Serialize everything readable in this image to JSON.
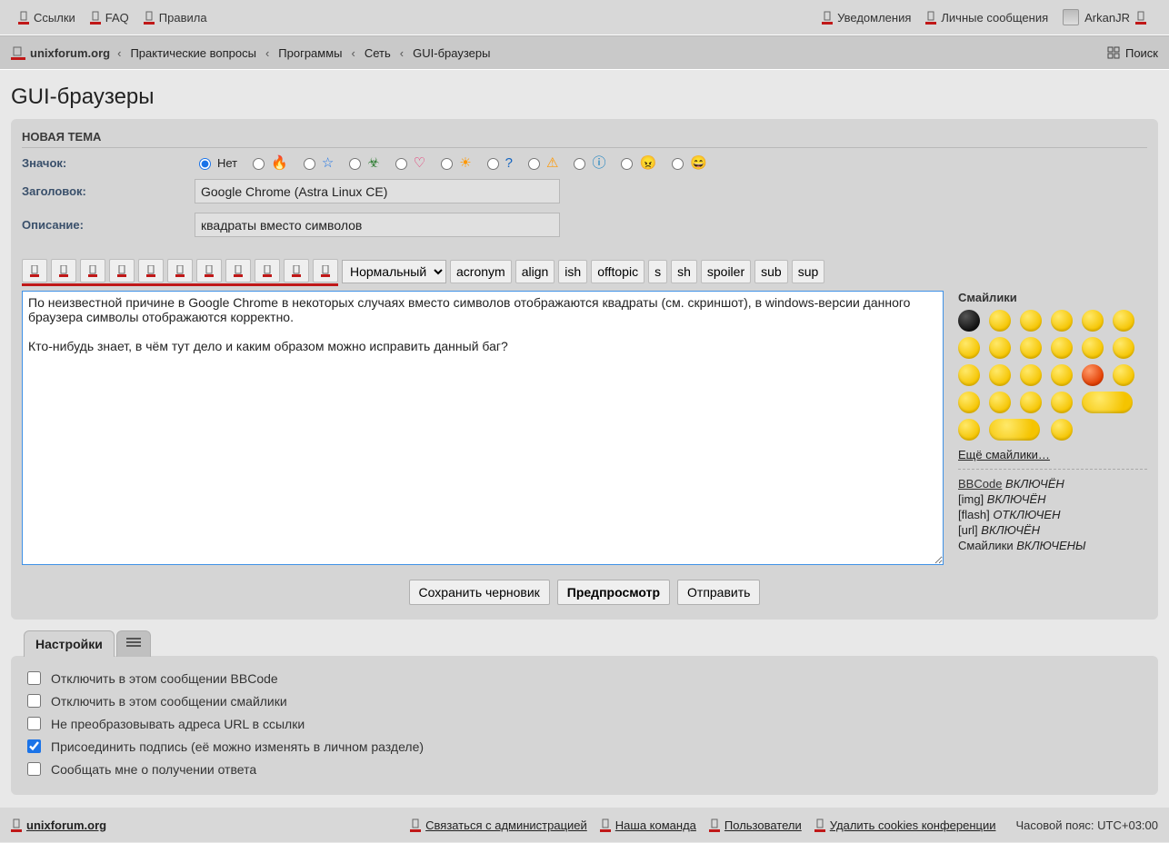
{
  "topbar": {
    "left": [
      {
        "label": "Ссылки"
      },
      {
        "label": "FAQ"
      },
      {
        "label": "Правила"
      }
    ],
    "right": [
      {
        "label": "Уведомления"
      },
      {
        "label": "Личные сообщения"
      }
    ],
    "username": "ArkanJR"
  },
  "breadcrumb": {
    "home": "unixforum.org",
    "items": [
      "Практические вопросы",
      "Программы",
      "Сеть",
      "GUI-браузеры"
    ],
    "search": "Поиск"
  },
  "page_title": "GUI-браузеры",
  "panel": {
    "heading": "НОВАЯ ТЕМА",
    "labels": {
      "icon": "Значок:",
      "subject": "Заголовок:",
      "desc": "Описание:"
    },
    "icon_none": "Нет",
    "subject_value": "Google Chrome (Astra Linux CE)",
    "desc_value": "квадраты вместо символов"
  },
  "topic_icons": [
    {
      "key": "none",
      "label": "Нет",
      "checked": true
    },
    {
      "key": "fire",
      "glyph": "🔥"
    },
    {
      "key": "star",
      "glyph": "☆",
      "color": "#1a73e8"
    },
    {
      "key": "biohazard",
      "glyph": "☣",
      "color": "#2e7d32"
    },
    {
      "key": "heart",
      "glyph": "♡",
      "color": "#e91e63"
    },
    {
      "key": "sun",
      "glyph": "☀",
      "color": "#ff9800"
    },
    {
      "key": "help",
      "glyph": "?",
      "color": "#1565c0"
    },
    {
      "key": "warn",
      "glyph": "⚠",
      "color": "#ff9800"
    },
    {
      "key": "info",
      "glyph": "ⓘ",
      "color": "#0277bd"
    },
    {
      "key": "angry",
      "glyph": "😠"
    },
    {
      "key": "mrgreen",
      "glyph": "😄"
    }
  ],
  "format_buttons_count": 11,
  "fontsize_selected": "Нормальный",
  "bbcode_buttons": [
    "acronym",
    "align",
    "ish",
    "offtopic",
    "s",
    "sh",
    "spoiler",
    "sub",
    "sup"
  ],
  "message": "По неизвестной причине в Google Chrome в некоторых случаях вместо символов отображаются квадраты (см. скриншот), в windows-версии данного браузера символы отображаются корректно.\n\nКто-нибудь знает, в чём тут дело и каким образом можно исправить данный баг?",
  "side": {
    "heading": "Смайлики",
    "more": "Ещё смайлики…",
    "status": {
      "bbcode_label": "BBCode",
      "bbcode_state": "ВКЛЮЧЁН",
      "img_label": "[img]",
      "img_state": "ВКЛЮЧЁН",
      "flash_label": "[flash]",
      "flash_state": "ОТКЛЮЧЕН",
      "url_label": "[url]",
      "url_state": "ВКЛЮЧЁН",
      "smilies_label": "Смайлики",
      "smilies_state": "ВКЛЮЧЕНЫ"
    }
  },
  "actions": {
    "save": "Сохранить черновик",
    "preview": "Предпросмотр",
    "submit": "Отправить"
  },
  "tabs": {
    "settings": "Настройки"
  },
  "settings_options": [
    {
      "key": "disable_bbcode",
      "label": "Отключить в этом сообщении BBCode",
      "checked": false
    },
    {
      "key": "disable_smilies",
      "label": "Отключить в этом сообщении смайлики",
      "checked": false
    },
    {
      "key": "disable_magic_url",
      "label": "Не преобразовывать адреса URL в ссылки",
      "checked": false
    },
    {
      "key": "attach_sig",
      "label": "Присоединить подпись (её можно изменять в личном разделе)",
      "checked": true
    },
    {
      "key": "notify_reply",
      "label": "Сообщать мне о получении ответа",
      "checked": false
    }
  ],
  "footer": {
    "home": "unixforum.org",
    "links": [
      "Связаться с администрацией",
      "Наша команда",
      "Пользователи",
      "Удалить cookies конференции"
    ],
    "tz": "Часовой пояс: UTC+03:00"
  }
}
